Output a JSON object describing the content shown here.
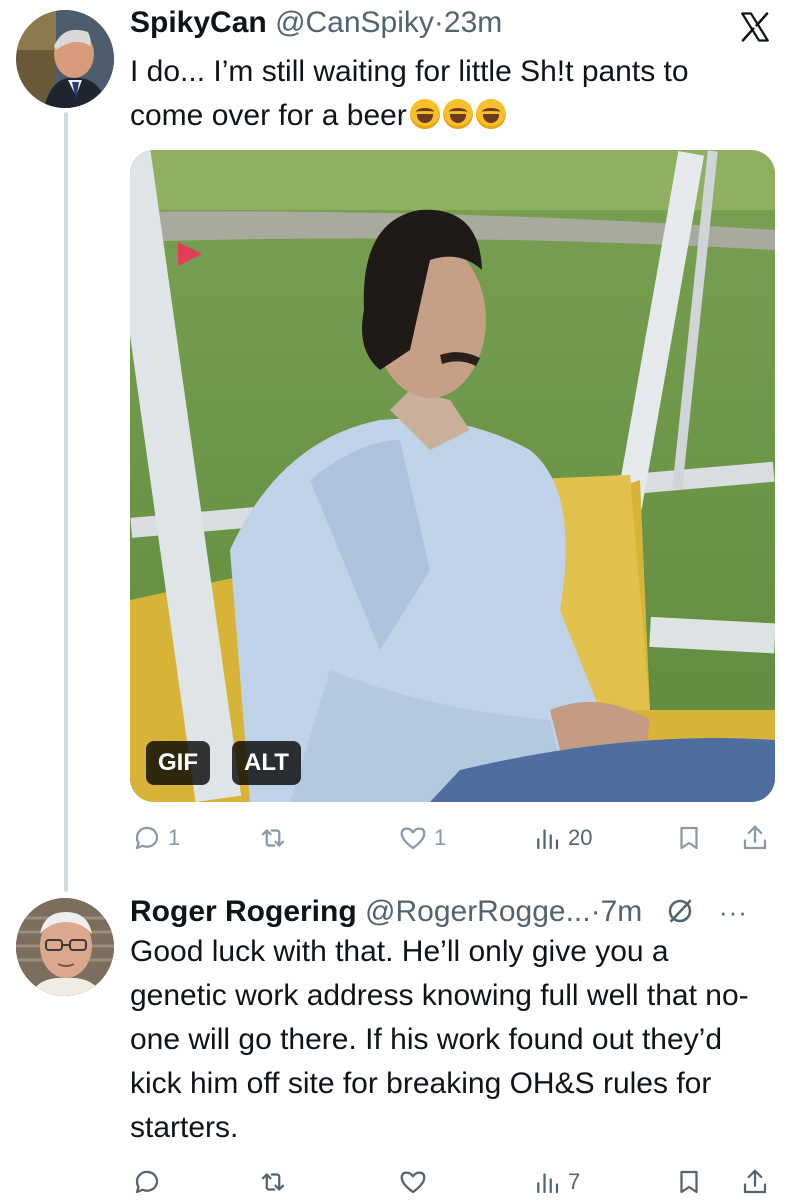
{
  "tweet1": {
    "name": "SpikyCan",
    "handle": "@CanSpiky",
    "separator": "·",
    "time": "23m",
    "text": "I do... I’m still waiting for little Sh!t pants to come over for a beer",
    "emojis": [
      "rolling-on-floor-laughing",
      "rolling-on-floor-laughing",
      "rolling-on-floor-laughing"
    ],
    "media": {
      "gif_label": "GIF",
      "alt_label": "ALT"
    },
    "actions": {
      "replies": "1",
      "reposts": "",
      "likes": "1",
      "views": "20"
    }
  },
  "tweet2": {
    "name": "Roger Rogering",
    "handle": "@RogerRogge...",
    "separator": "·",
    "time": "7m",
    "more": "···",
    "text": "Good luck with that. He’ll only give you a genetic work address knowing full well that no-one will go there. If his work found out they’d kick him off site for breaking OH&S rules for starters.",
    "actions": {
      "replies": "",
      "reposts": "",
      "likes": "",
      "views": "7"
    }
  },
  "colors": {
    "text_primary": "#0f1419",
    "text_secondary": "#536471",
    "thread_line": "#cfd9de",
    "emoji_yellow": "#f7c02a"
  }
}
